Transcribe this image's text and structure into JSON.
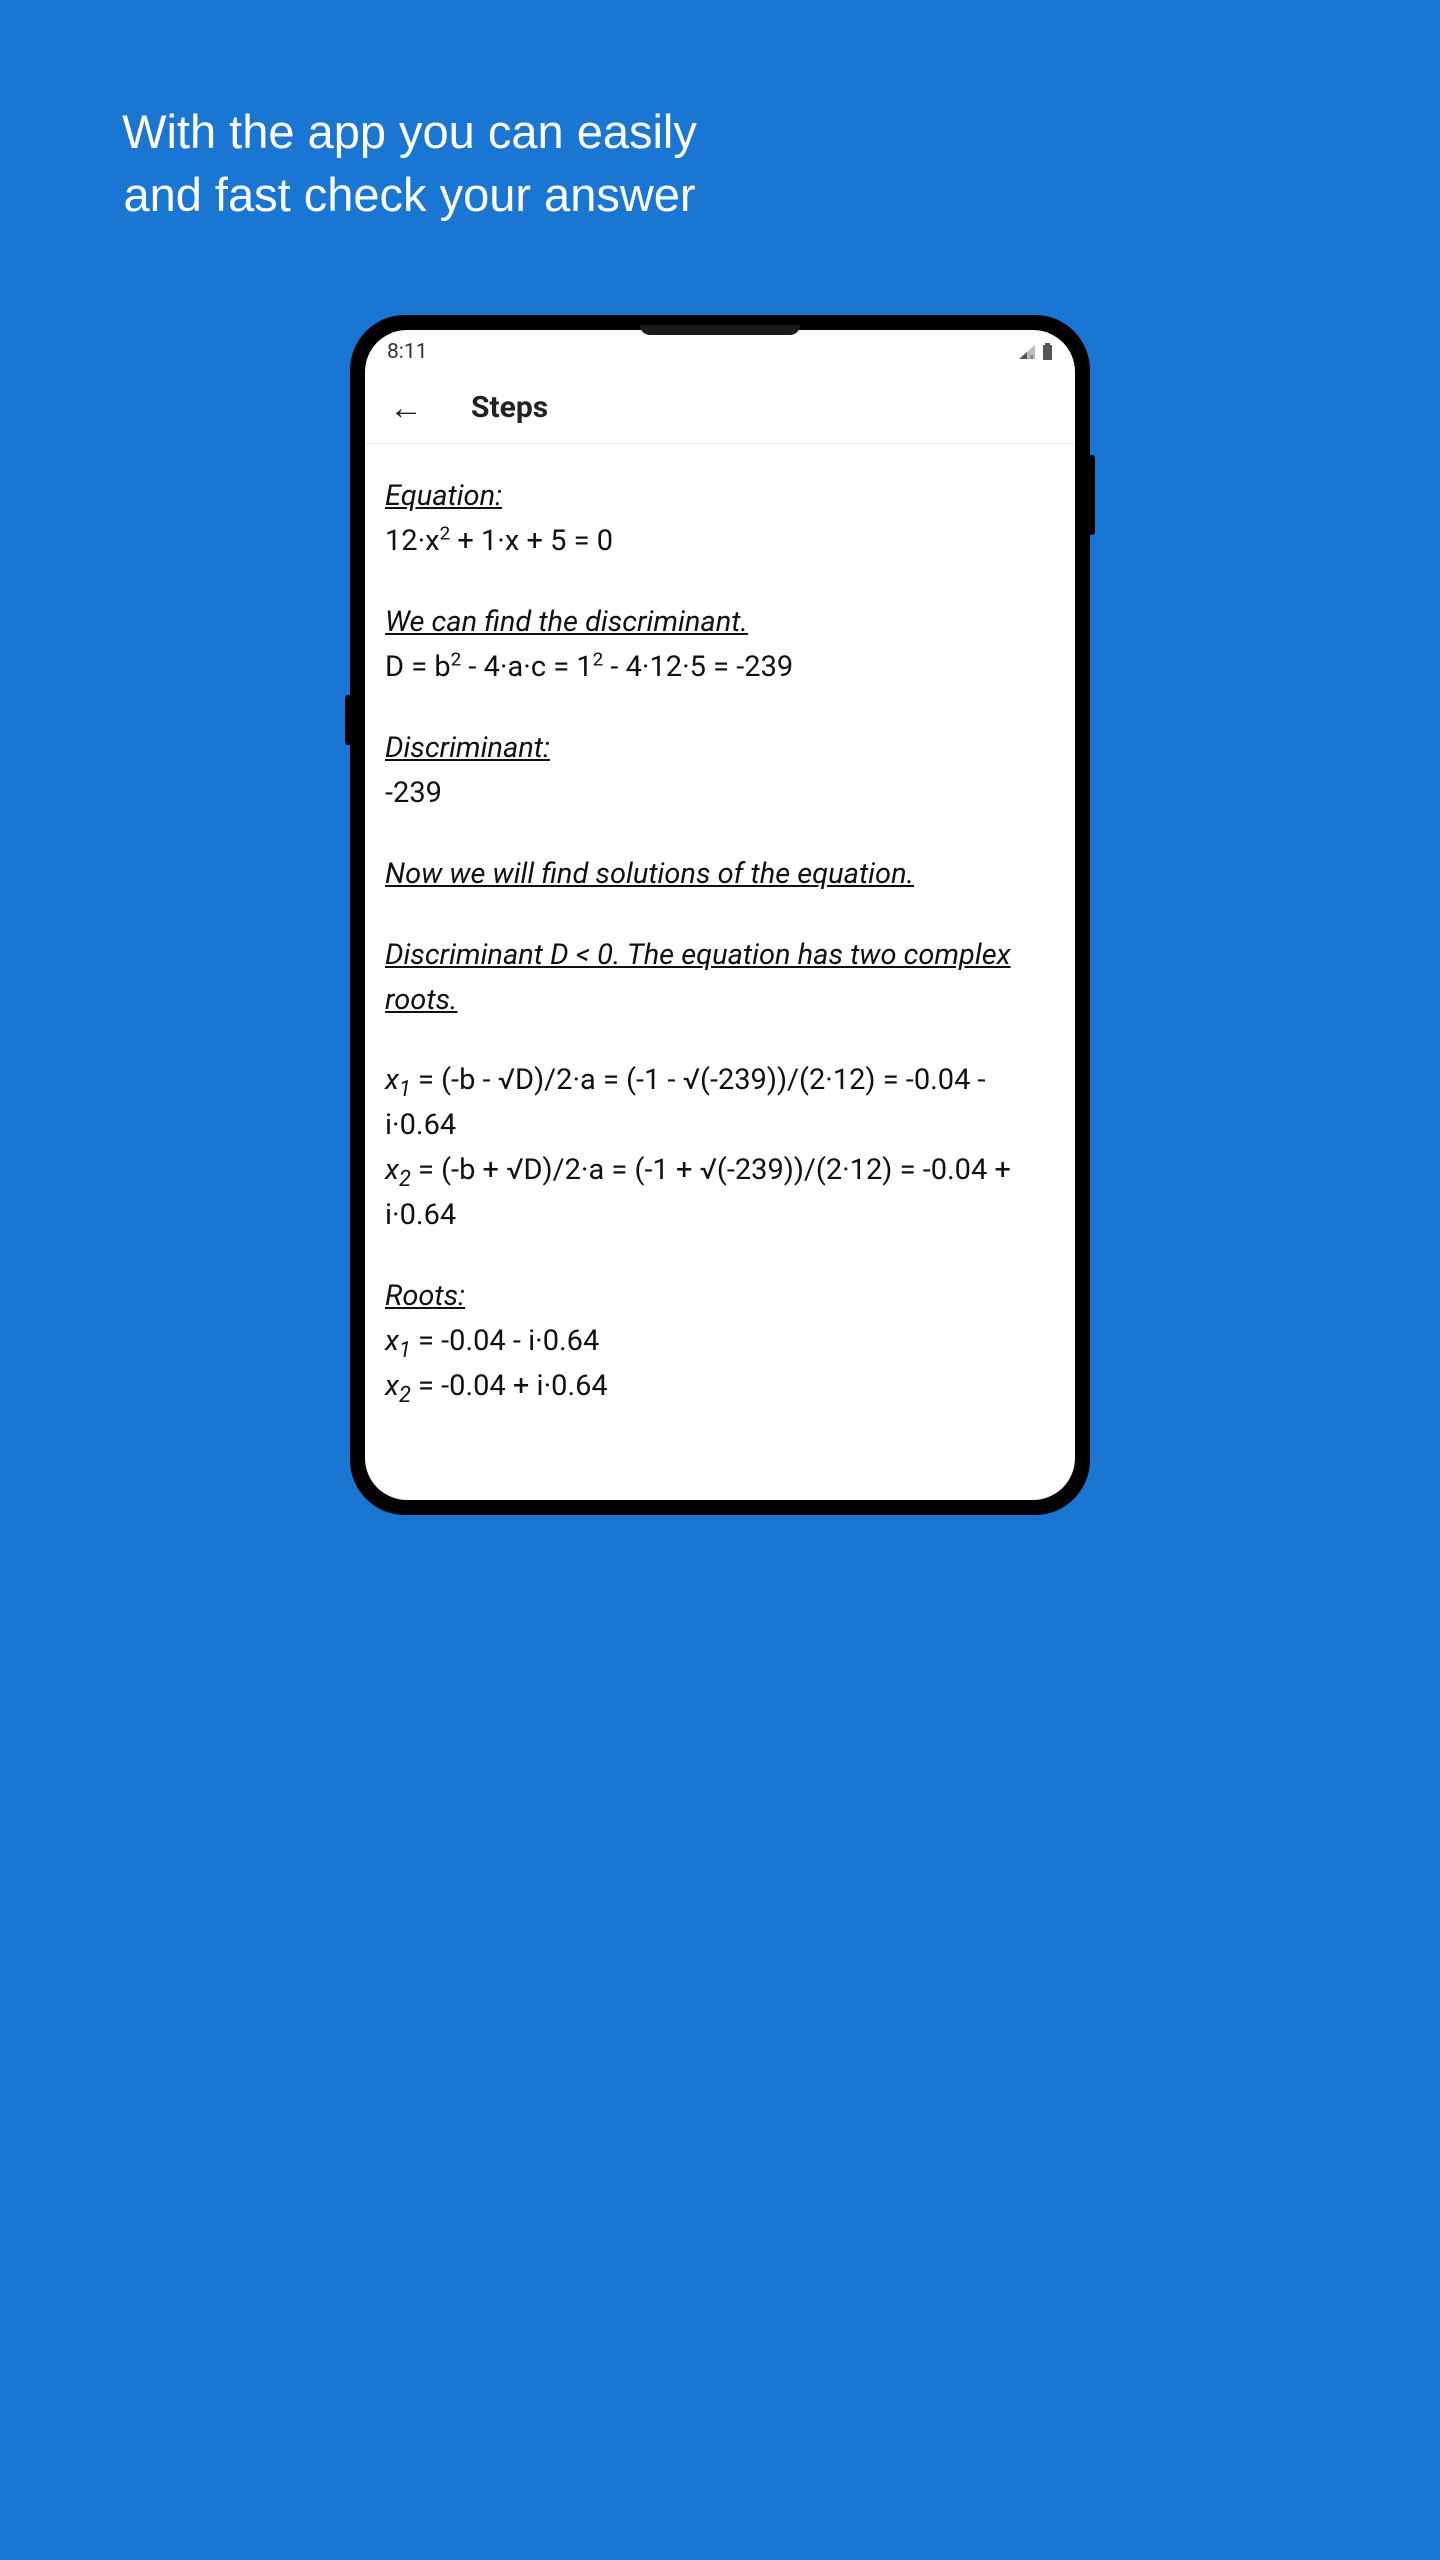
{
  "promo": {
    "line1": "With the app you can easily",
    "line2": "and fast check your answer"
  },
  "statusbar": {
    "time": "8:11"
  },
  "appbar": {
    "title": "Steps"
  },
  "steps": {
    "equation_label": "Equation:",
    "equation_pre": "12·x",
    "equation_post": " + 1·x + 5 = 0",
    "discriminant_find_label": "We can find the discriminant.",
    "discriminant_formula_pre": "D = b",
    "discriminant_formula_mid": " - 4·a·c = 1",
    "discriminant_formula_post": " - 4·12·5 = -239",
    "discriminant_label": "Discriminant:",
    "discriminant_value": "-239",
    "solutions_label": "Now we will find solutions of the equation.",
    "complex_label": "Discriminant D < 0. The equation has two complex roots.",
    "x1_sub": "1",
    "x1_val": " = (-b - √D)/2·a = (-1 - √(-239))/(2·12) = -0.04 - i·0.64",
    "x2_sub": "2",
    "x2_val": " = (-b + √D)/2·a = (-1 + √(-239))/(2·12) = -0.04 + i·0.64",
    "roots_label": "Roots: ",
    "root1": " = -0.04 - i·0.64",
    "root2": " = -0.04 + i·0.64",
    "sup2": "2",
    "x": "x"
  }
}
